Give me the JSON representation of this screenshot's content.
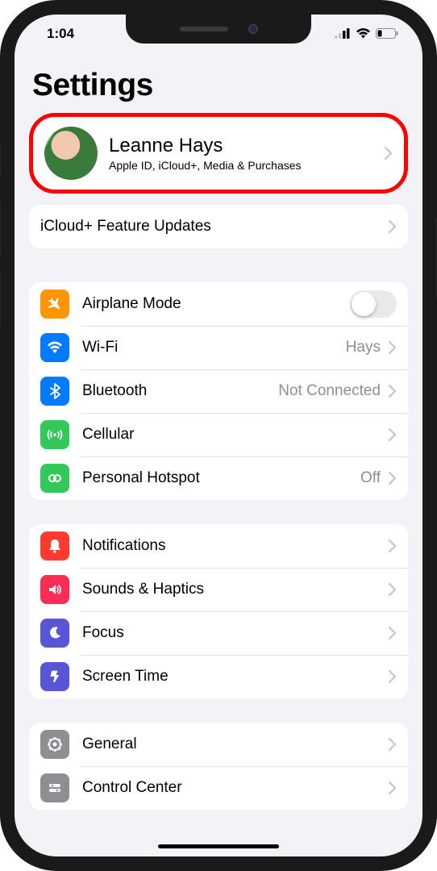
{
  "statusBar": {
    "time": "1:04"
  },
  "pageTitle": "Settings",
  "profile": {
    "name": "Leanne Hays",
    "subtitle": "Apple ID, iCloud+, Media & Purchases"
  },
  "featureUpdates": {
    "label": "iCloud+ Feature Updates"
  },
  "connectivity": {
    "airplane": {
      "label": "Airplane Mode",
      "on": false,
      "iconColor": "#ff9500"
    },
    "wifi": {
      "label": "Wi-Fi",
      "value": "Hays",
      "iconColor": "#007aff"
    },
    "bluetooth": {
      "label": "Bluetooth",
      "value": "Not Connected",
      "iconColor": "#007aff"
    },
    "cellular": {
      "label": "Cellular",
      "value": "",
      "iconColor": "#34c759"
    },
    "hotspot": {
      "label": "Personal Hotspot",
      "value": "Off",
      "iconColor": "#34c759"
    }
  },
  "system": {
    "notifications": {
      "label": "Notifications",
      "iconColor": "#ff3b30"
    },
    "sounds": {
      "label": "Sounds & Haptics",
      "iconColor": "#ff2d55"
    },
    "focus": {
      "label": "Focus",
      "iconColor": "#5856d6"
    },
    "screentime": {
      "label": "Screen Time",
      "iconColor": "#5856d6"
    }
  },
  "general": {
    "general": {
      "label": "General",
      "iconColor": "#8e8e93"
    },
    "controlcenter": {
      "label": "Control Center",
      "iconColor": "#8e8e93"
    }
  }
}
